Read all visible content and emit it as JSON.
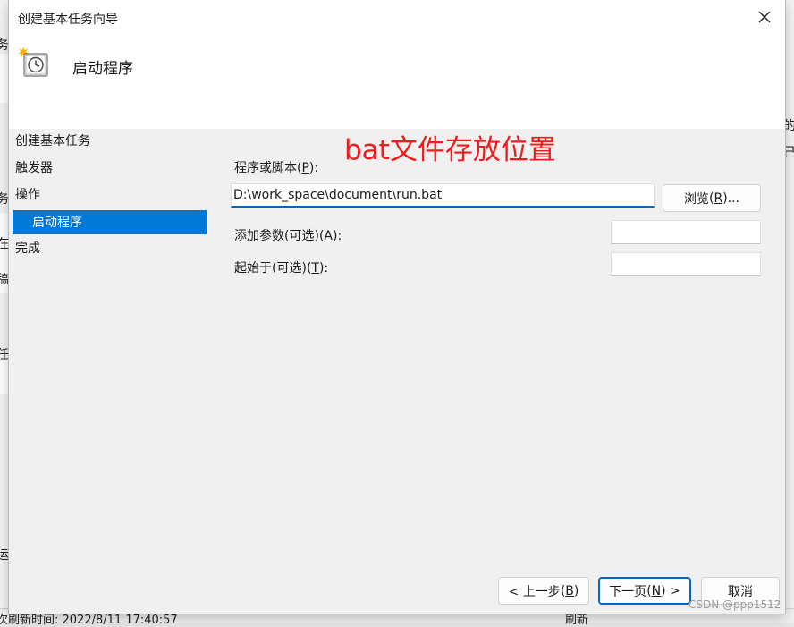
{
  "background": {
    "left_fragments": [
      "务",
      "务",
      "在",
      "稿",
      "任",
      "运"
    ],
    "right_fragments": [
      "的",
      "己"
    ],
    "bottom_left": "次刷新时间: 2022/8/11 17:40:57",
    "bottom_right": "刷新"
  },
  "dialog": {
    "title": "创建基本任务向导",
    "header_title": "启动程序",
    "close_icon": "close-icon"
  },
  "nav": {
    "items": [
      {
        "label": "创建基本任务"
      },
      {
        "label": "触发器"
      },
      {
        "label": "操作"
      },
      {
        "label": "启动程序",
        "selected": true
      },
      {
        "label": "完成"
      }
    ]
  },
  "annotation": {
    "text": "bat文件存放位置",
    "color": "#ee1c1c"
  },
  "form": {
    "script_label": "程序或脚本",
    "script_hotkey": "P",
    "script_value": "D:\\work_space\\document\\run.bat",
    "browse_label": "浏览",
    "browse_hotkey": "R",
    "args_label": "添加参数(可选)",
    "args_hotkey": "A",
    "args_value": "",
    "start_label": "起始于(可选)",
    "start_hotkey": "T",
    "start_value": ""
  },
  "footer": {
    "back_label": "< 上一步",
    "back_hotkey": "B",
    "next_label": "下一页",
    "next_hotkey": "N",
    "next_suffix": " >",
    "cancel_label": "取消"
  },
  "watermark": "CSDN @ppp1512",
  "colors": {
    "accent": "#0078d7",
    "annotation": "#ee1c1c"
  }
}
